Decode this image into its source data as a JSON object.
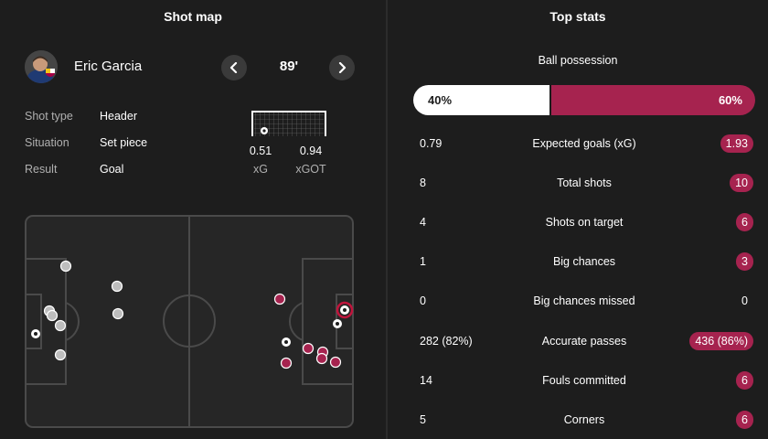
{
  "shot_map": {
    "title": "Shot map",
    "player": {
      "name": "Eric Garcia",
      "minute": "89'"
    },
    "details": [
      {
        "label": "Shot type",
        "value": "Header"
      },
      {
        "label": "Situation",
        "value": "Set piece"
      },
      {
        "label": "Result",
        "value": "Goal"
      }
    ],
    "xg": {
      "value": "0.51",
      "label": "xG"
    },
    "xgot": {
      "value": "0.94",
      "label": "xGOT"
    },
    "colors": {
      "home_shot": "#bdbdbd",
      "away_shot": "#a6234f",
      "highlight": "#c0143c"
    }
  },
  "top_stats": {
    "title": "Top stats",
    "possession": {
      "label": "Ball possession",
      "home": "40%",
      "away": "60%",
      "home_pct": 40,
      "away_pct": 60
    },
    "rows": [
      {
        "home": "0.79",
        "label": "Expected goals (xG)",
        "away": "1.93",
        "away_highlight": true
      },
      {
        "home": "8",
        "label": "Total shots",
        "away": "10",
        "away_highlight": true
      },
      {
        "home": "4",
        "label": "Shots on target",
        "away": "6",
        "away_highlight": true
      },
      {
        "home": "1",
        "label": "Big chances",
        "away": "3",
        "away_highlight": true
      },
      {
        "home": "0",
        "label": "Big chances missed",
        "away": "0",
        "away_highlight": false
      },
      {
        "home": "282 (82%)",
        "label": "Accurate passes",
        "away": "436 (86%)",
        "away_highlight": true
      },
      {
        "home": "14",
        "label": "Fouls committed",
        "away": "6",
        "away_highlight": true
      },
      {
        "home": "5",
        "label": "Corners",
        "away": "6",
        "away_highlight": true
      }
    ]
  }
}
